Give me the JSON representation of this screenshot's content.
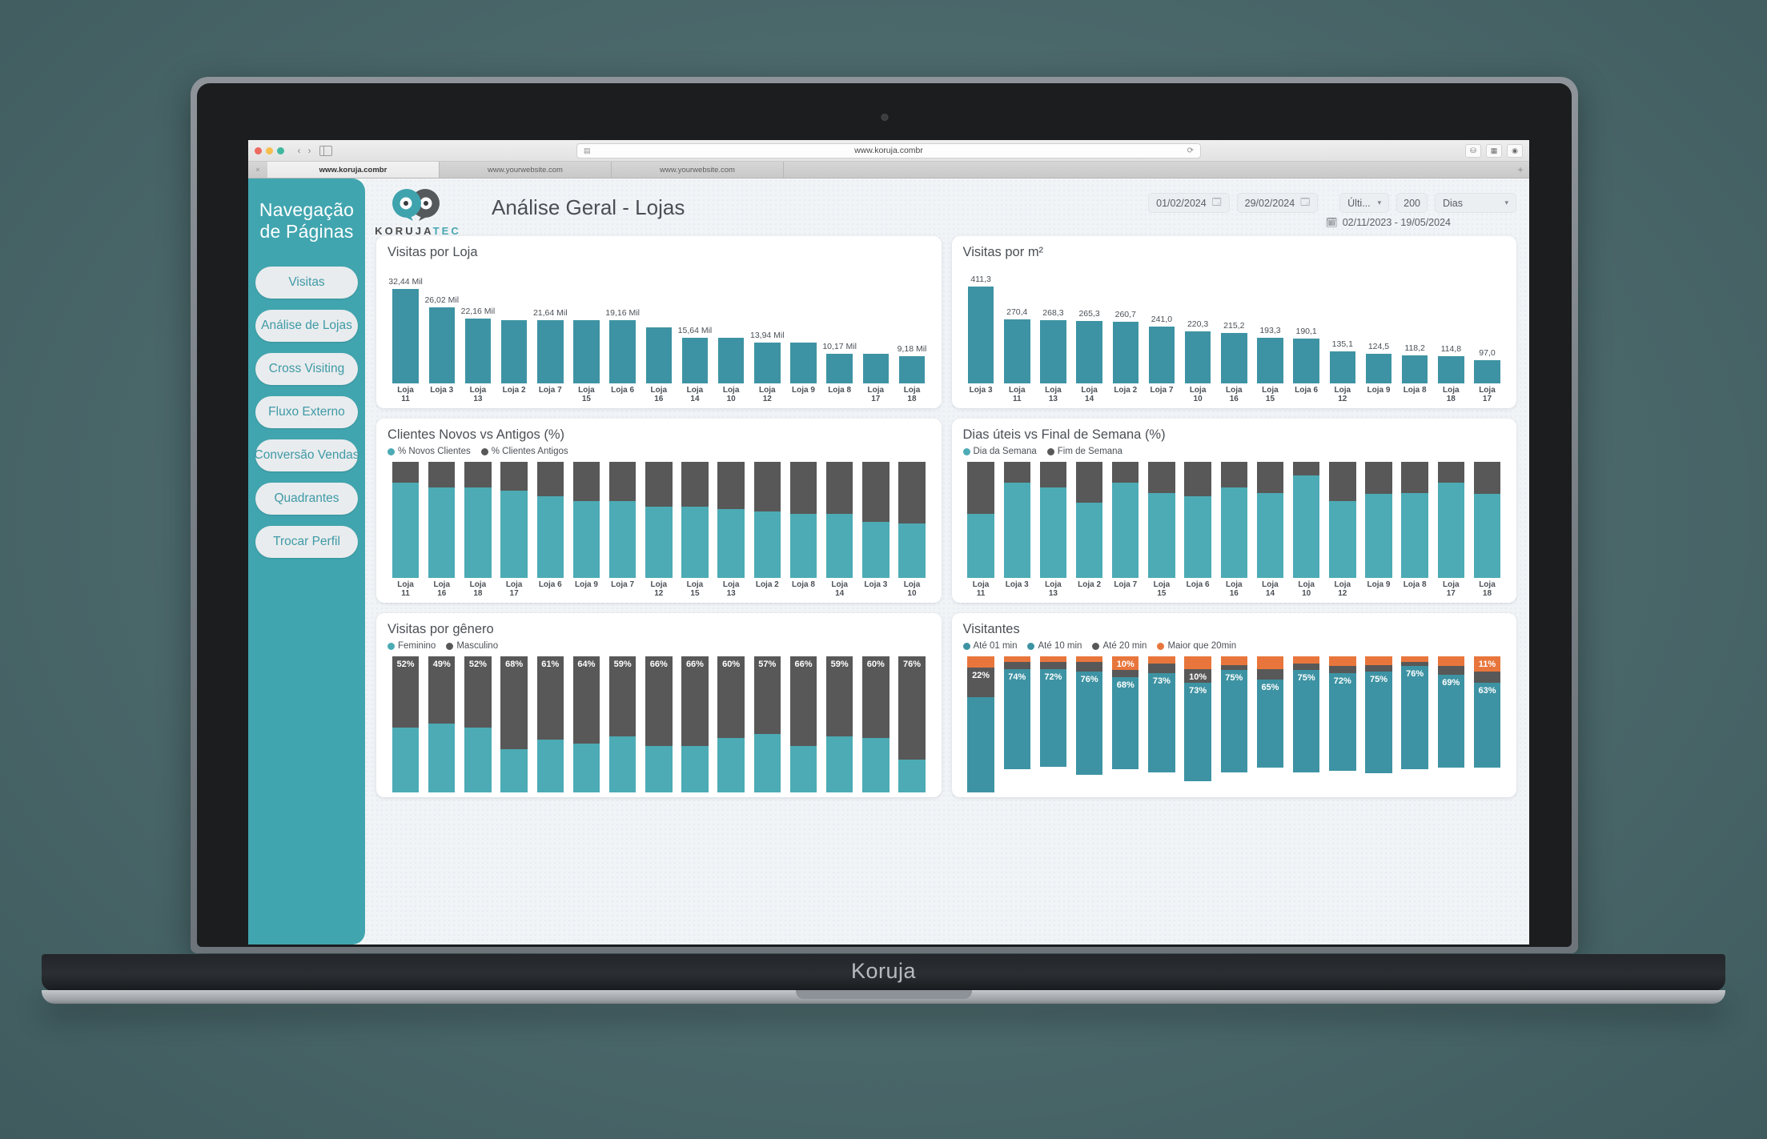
{
  "browser": {
    "url": "www.koruja.combr",
    "reload_icon": "reload-icon",
    "tabs": [
      {
        "label": "www.koruja.combr",
        "active": true
      },
      {
        "label": "www.yourwebsite.com",
        "active": false
      },
      {
        "label": "www.yourwebsite.com",
        "active": false
      }
    ],
    "new_tab_label": "+",
    "tab_close_label": "×",
    "back_label": "‹",
    "forward_label": "›",
    "toolbar_icons": [
      "share-icon",
      "tabs-icon",
      "settings-icon"
    ]
  },
  "laptop": {
    "brand": "Koruja"
  },
  "sidebar": {
    "title": "Navegação\nde Páginas",
    "accent": "#41a5af",
    "items": [
      {
        "label": "Visitas"
      },
      {
        "label": "Análise de Lojas"
      },
      {
        "label": "Cross Visiting"
      },
      {
        "label": "Fluxo Externo"
      },
      {
        "label": "Conversão Vendas"
      },
      {
        "label": "Quadrantes"
      },
      {
        "label": "Trocar Perfil"
      }
    ]
  },
  "header": {
    "title": "Análise Geral - Lojas",
    "logo": {
      "word_dark": "KORUJA",
      "word_teal": "TEC",
      "icon": "owl-logo-icon"
    },
    "date_from": "01/02/2024",
    "date_to": "29/02/2024",
    "period_select": "Últi...",
    "period_count": "200",
    "unit_select": "Dias",
    "range_text": "02/11/2023 - 19/05/2024",
    "calendar_icon": "calendar-icon",
    "chevron_icon": "chevron-down-icon"
  },
  "colors": {
    "teal": "#3d93a3",
    "teal_light": "#4cabb5",
    "gray": "#585858",
    "orange": "#e8763c",
    "card_bg": "#ffffff"
  },
  "chart_data": [
    {
      "id": "visitas-por-loja",
      "type": "bar",
      "title": "Visitas por Loja",
      "xlabel": "",
      "ylabel": "",
      "grid": false,
      "legend": null,
      "ylim": [
        0,
        32440
      ],
      "categories": [
        "Loja\n11",
        "Loja 3",
        "Loja\n13",
        "Loja 2",
        "Loja 7",
        "Loja\n15",
        "Loja 6",
        "Loja\n16",
        "Loja\n14",
        "Loja\n10",
        "Loja\n12",
        "Loja 9",
        "Loja 8",
        "Loja\n17",
        "Loja\n18"
      ],
      "values": [
        32440,
        26020,
        22160,
        21640,
        21640,
        21640,
        21640,
        19160,
        15640,
        15640,
        13940,
        13940,
        10170,
        10170,
        9180
      ],
      "data_labels": [
        "32,44 Mil",
        "26,02 Mil",
        "22,16 Mil",
        "",
        "21,64 Mil",
        "",
        "19,16 Mil",
        "",
        "15,64 Mil",
        "",
        "13,94 Mil",
        "",
        "10,17 Mil",
        "",
        "9,18 Mil"
      ]
    },
    {
      "id": "visitas-por-m2",
      "type": "bar",
      "title": "Visitas por m²",
      "xlabel": "",
      "ylabel": "",
      "grid": false,
      "legend": null,
      "ylim": [
        0,
        411.3
      ],
      "categories": [
        "Loja 3",
        "Loja\n11",
        "Loja\n13",
        "Loja\n14",
        "Loja 2",
        "Loja 7",
        "Loja\n10",
        "Loja\n16",
        "Loja\n15",
        "Loja 6",
        "Loja\n12",
        "Loja 9",
        "Loja 8",
        "Loja\n18",
        "Loja\n17"
      ],
      "values": [
        411.3,
        270.4,
        268.3,
        265.3,
        260.7,
        241.0,
        220.3,
        215.2,
        193.3,
        190.1,
        135.1,
        124.5,
        118.2,
        114.8,
        97.0
      ],
      "data_labels": [
        "411,3",
        "270,4",
        "268,3",
        "265,3",
        "260,7",
        "241,0",
        "220,3",
        "215,2",
        "193,3",
        "190,1",
        "135,1",
        "124,5",
        "118,2",
        "114,8",
        "97,0"
      ]
    },
    {
      "id": "clientes-novos-vs-antigos",
      "type": "bar",
      "stacked": true,
      "title": "Clientes Novos vs Antigos (%)",
      "xlabel": "",
      "ylabel": "",
      "grid": false,
      "legend": {
        "position": "top",
        "entries": [
          "% Novos Clientes",
          "% Clientes Antigos"
        ]
      },
      "ylim": [
        0,
        100
      ],
      "categories": [
        "Loja\n11",
        "Loja\n16",
        "Loja\n18",
        "Loja\n17",
        "Loja 6",
        "Loja 9",
        "Loja 7",
        "Loja\n12",
        "Loja\n15",
        "Loja\n13",
        "Loja 2",
        "Loja 8",
        "Loja\n14",
        "Loja 3",
        "Loja\n10"
      ],
      "series": [
        {
          "name": "% Novos Clientes",
          "color": "#4cabb5",
          "values": [
            82,
            78,
            78,
            75,
            70,
            66,
            66,
            61,
            61,
            59,
            57,
            55,
            55,
            48,
            47
          ]
        },
        {
          "name": "% Clientes Antigos",
          "color": "#585858",
          "values": [
            18,
            22,
            22,
            25,
            30,
            34,
            34,
            39,
            39,
            41,
            43,
            45,
            45,
            52,
            53
          ]
        }
      ]
    },
    {
      "id": "dias-uteis-vs-final-de-semana",
      "type": "bar",
      "stacked": true,
      "title": "Dias úteis vs Final de Semana (%)",
      "xlabel": "",
      "ylabel": "",
      "grid": false,
      "legend": {
        "position": "top",
        "entries": [
          "Dia da Semana",
          "Fim de Semana"
        ]
      },
      "ylim": [
        0,
        100
      ],
      "categories": [
        "Loja\n11",
        "Loja 3",
        "Loja\n13",
        "Loja 2",
        "Loja 7",
        "Loja\n15",
        "Loja 6",
        "Loja\n16",
        "Loja\n14",
        "Loja\n10",
        "Loja\n12",
        "Loja 9",
        "Loja 8",
        "Loja\n17",
        "Loja\n18"
      ],
      "series": [
        {
          "name": "Dia da Semana",
          "color": "#4cabb5",
          "values": [
            55,
            82,
            78,
            65,
            82,
            73,
            70,
            78,
            73,
            88,
            66,
            72,
            73,
            82,
            72
          ]
        },
        {
          "name": "Fim de Semana",
          "color": "#585858",
          "values": [
            45,
            18,
            22,
            35,
            18,
            27,
            30,
            22,
            27,
            12,
            34,
            28,
            27,
            18,
            28
          ]
        }
      ]
    },
    {
      "id": "visitas-por-genero",
      "type": "bar",
      "stacked": true,
      "clipped": true,
      "title": "Visitas por gênero",
      "xlabel": "",
      "ylabel": "",
      "grid": false,
      "legend": {
        "position": "top",
        "entries": [
          "Feminino",
          "Masculino"
        ]
      },
      "ylim": [
        0,
        100
      ],
      "categories": [
        "",
        "",
        "",
        "",
        "",
        "",
        "",
        "",
        "",
        "",
        "",
        "",
        "",
        "",
        ""
      ],
      "series": [
        {
          "name": "Masculino",
          "color": "#585858",
          "values": [
            52,
            49,
            52,
            68,
            61,
            64,
            59,
            66,
            66,
            60,
            57,
            66,
            59,
            60,
            76
          ],
          "data_labels": [
            "52%",
            "49%",
            "52%",
            "68%",
            "61%",
            "64%",
            "59%",
            "66%",
            "66%",
            "60%",
            "57%",
            "66%",
            "59%",
            "60%",
            "76%"
          ]
        },
        {
          "name": "Feminino",
          "color": "#4cabb5",
          "values": [
            48,
            51,
            48,
            32,
            39,
            36,
            41,
            34,
            34,
            40,
            43,
            34,
            41,
            40,
            24
          ],
          "data_labels": []
        }
      ]
    },
    {
      "id": "visitantes",
      "type": "bar",
      "stacked": true,
      "clipped": true,
      "title": "Visitantes",
      "xlabel": "",
      "ylabel": "",
      "grid": false,
      "legend": {
        "position": "top",
        "entries": [
          "Até 01 min",
          "Até 10 min",
          "Até 20 min",
          "Maior que 20min"
        ]
      },
      "ylim": [
        0,
        100
      ],
      "categories": [
        "",
        "",
        "",
        "",
        "",
        "",
        "",
        "",
        "",
        "",
        "",
        "",
        "",
        "",
        ""
      ],
      "series": [
        {
          "name": "Maior que 20min",
          "color": "#e8763c",
          "values": [
            8,
            4,
            4,
            4,
            10,
            5,
            9,
            6,
            9,
            5,
            7,
            6,
            4,
            7,
            11
          ],
          "data_labels": [
            "",
            "",
            "",
            "",
            "10%",
            "",
            "",
            "",
            "",
            "",
            "",
            "",
            "",
            "",
            "11%"
          ]
        },
        {
          "name": "Até 20 min",
          "color": "#585858",
          "values": [
            22,
            5,
            5,
            7,
            5,
            7,
            10,
            4,
            8,
            5,
            5,
            5,
            3,
            6,
            8
          ],
          "data_labels": [
            "22%",
            "",
            "",
            "",
            "",
            "",
            "10%",
            "",
            "",
            "",
            "",
            "",
            "",
            "",
            ""
          ]
        },
        {
          "name": "Até 10 min",
          "color": "#3d93a3",
          "values": [
            70,
            74,
            72,
            76,
            68,
            73,
            73,
            75,
            65,
            75,
            72,
            75,
            76,
            69,
            63
          ],
          "data_labels": [
            "",
            "74%",
            "72%",
            "76%",
            "68%",
            "73%",
            "73%",
            "75%",
            "65%",
            "75%",
            "72%",
            "75%",
            "76%",
            "69%",
            "63%"
          ]
        },
        {
          "name": "Até 01 min",
          "color": "#3d93a3",
          "values": [
            0,
            0,
            0,
            0,
            0,
            0,
            0,
            0,
            0,
            0,
            0,
            0,
            0,
            0,
            0
          ],
          "data_labels": []
        }
      ]
    }
  ]
}
